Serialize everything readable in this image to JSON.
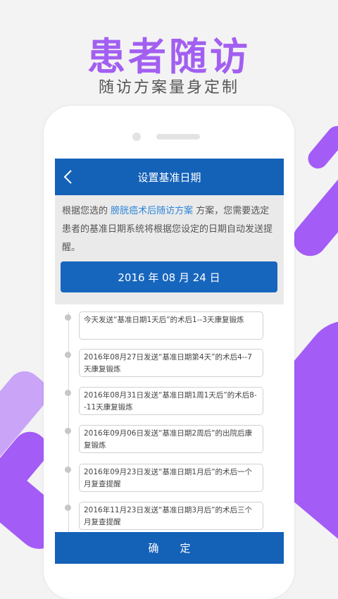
{
  "promo": {
    "title": "患者随访",
    "subtitle": "随访方案量身定制"
  },
  "header": {
    "back_icon": "chevron-left-icon",
    "title": "设置基准日期"
  },
  "intro": {
    "text_before": "根据您选的 ",
    "plan_name": "膀胱癌术后随访方案",
    "text_after": " 方案，您需要选定患者的基准日期系统将根据您设定的日期自动发送提醒。"
  },
  "date_button": {
    "label": "2016 年 08 月 24 日"
  },
  "timeline": [
    "今天发送“基准日期1天后”的术后1--3天康复锻炼",
    "2016年08月27日发送“基准日期第4天”的术后4--7天康复锻炼",
    "2016年08月31日发送“基准日期1周1天后”的术后8--11天康复锻炼",
    "2016年09月06日发送“基准日期2周后”的出院后康复锻炼",
    "2016年09月23日发送“基准日期1月后”的术后一个月复查提醒",
    "2016年11月23日发送“基准日期3月后”的术后三个月复查提醒"
  ],
  "confirm_button": {
    "label": "确定"
  },
  "colors": {
    "accent_purple": "#a25ff1",
    "primary_blue": "#1461b8",
    "link_blue": "#2d86d8"
  }
}
